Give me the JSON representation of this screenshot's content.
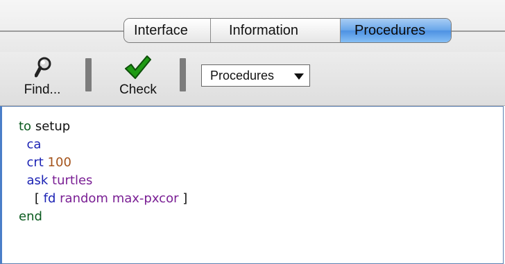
{
  "tabs": [
    {
      "label": "Interface",
      "active": false
    },
    {
      "label": "Information",
      "active": false
    },
    {
      "label": "Procedures",
      "active": true
    }
  ],
  "toolbar": {
    "find_label": "Find...",
    "check_label": "Check",
    "procedures_menu_label": "Procedures"
  },
  "colors": {
    "active_tab": "#6aa7ea",
    "keyword_green": "#0a5a1e",
    "command_blue": "#1c23b4",
    "reporter_purple": "#7a1f94",
    "number_brown": "#a4541c",
    "check_green": "#1f9a14"
  },
  "code": {
    "line1_kw": "to",
    "line1_name": "setup",
    "line2_cmd": "ca",
    "line3_cmd": "crt",
    "line3_num": "100",
    "line4_cmd": "ask",
    "line4_arg": "turtles",
    "line5_open": "[",
    "line5_cmd": "fd",
    "line5_rep": "random",
    "line5_arg": "max-pxcor",
    "line5_close": "]",
    "line6_kw": "end"
  }
}
